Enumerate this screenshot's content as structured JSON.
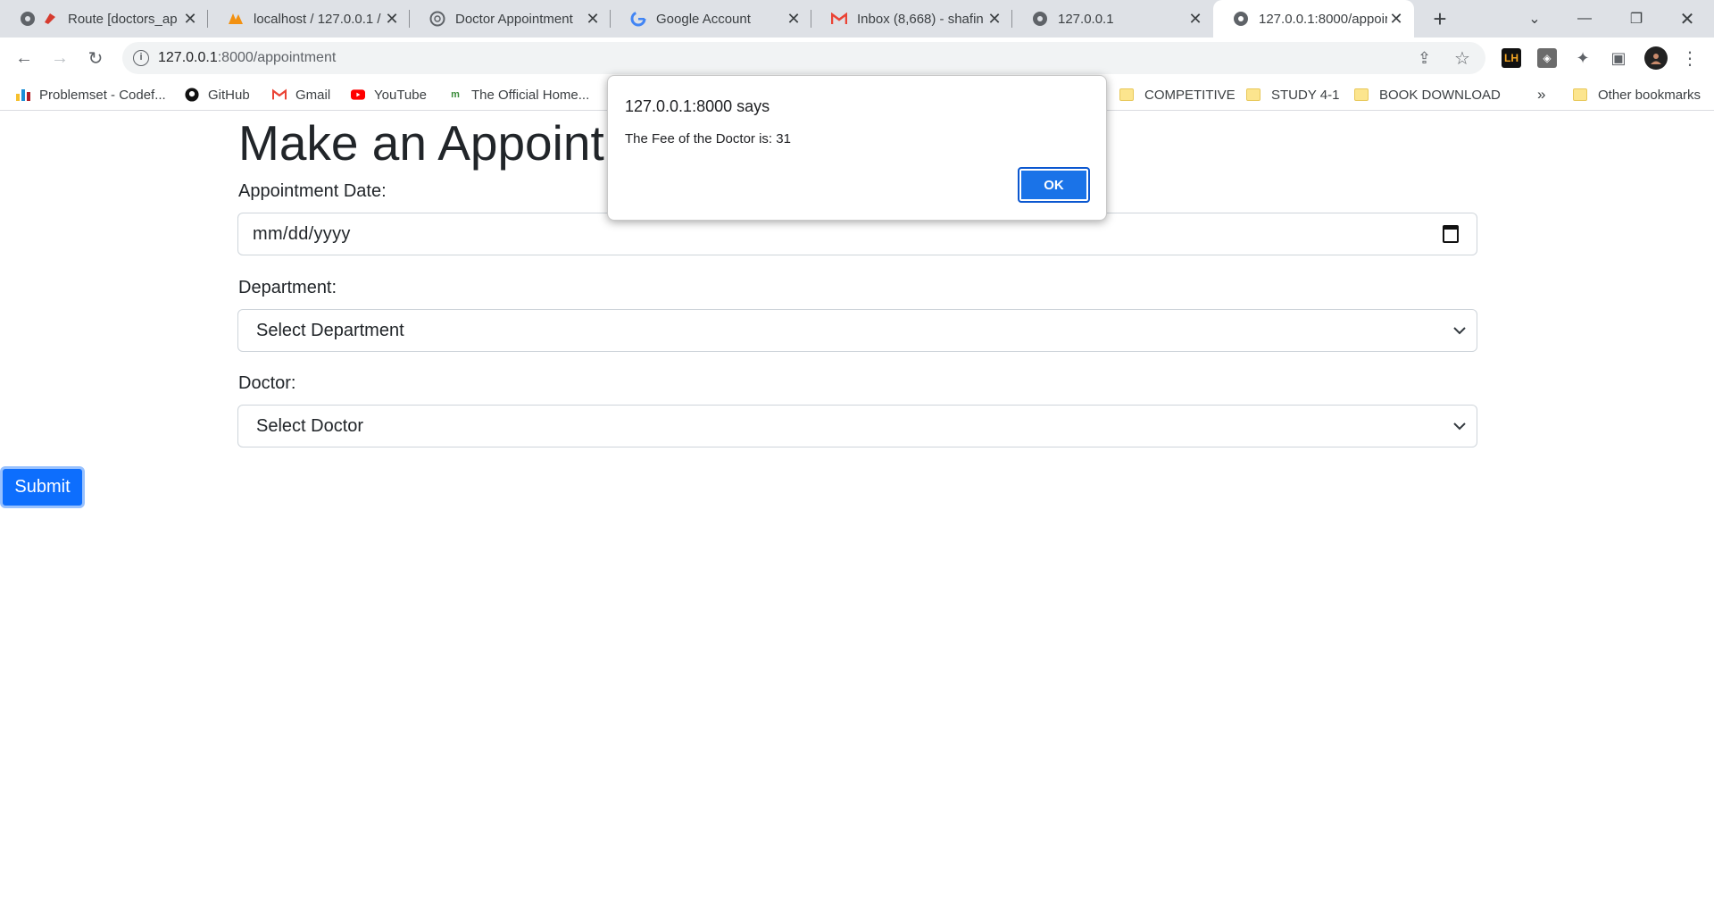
{
  "browser": {
    "tabs": [
      {
        "title": "Route [doctors_ap",
        "icon": "globe-icon"
      },
      {
        "title": "localhost / 127.0.0.1 /",
        "icon": "phpmyadmin-icon"
      },
      {
        "title": "Doctor Appointment",
        "icon": "chatgpt-icon"
      },
      {
        "title": "Google Account",
        "icon": "google-icon"
      },
      {
        "title": "Inbox (8,668) - shafin",
        "icon": "gmail-icon"
      },
      {
        "title": "127.0.0.1",
        "icon": "globe-icon"
      },
      {
        "title": "127.0.0.1:8000/appoir",
        "icon": "globe-icon"
      }
    ],
    "new_tab": "+",
    "url_host": "127.0.0.1",
    "url_path": ":8000/appointment",
    "bookmarks": [
      {
        "label": "Problemset - Codef...",
        "icon": "codeforces-icon"
      },
      {
        "label": "GitHub",
        "icon": "github-icon"
      },
      {
        "label": "Gmail",
        "icon": "gmail-icon"
      },
      {
        "label": "YouTube",
        "icon": "youtube-icon"
      },
      {
        "label": "The Official Home...",
        "icon": "site-icon"
      },
      {
        "label": "COMPETITIVE",
        "icon": "folder-icon"
      },
      {
        "label": "STUDY 4-1",
        "icon": "folder-icon"
      },
      {
        "label": "BOOK DOWNLOAD",
        "icon": "folder-icon"
      },
      {
        "label": "Other bookmarks",
        "icon": "folder-icon"
      }
    ],
    "more_bookmarks": "»"
  },
  "page": {
    "title": "Make an Appointm",
    "date_label": "Appointment Date:",
    "date_value": "mm/dd/yyyy",
    "department_label": "Department:",
    "department_value": "Select Department",
    "doctor_label": "Doctor:",
    "doctor_value": "Select Doctor",
    "submit_label": "Submit"
  },
  "dialog": {
    "title": "127.0.0.1:8000 says",
    "message": "The Fee of the Doctor is: 31",
    "ok_label": "OK"
  },
  "colors": {
    "primary": "#0d6efd",
    "dialog_button": "#1a73e8",
    "tabstrip": "#dee1e6"
  }
}
